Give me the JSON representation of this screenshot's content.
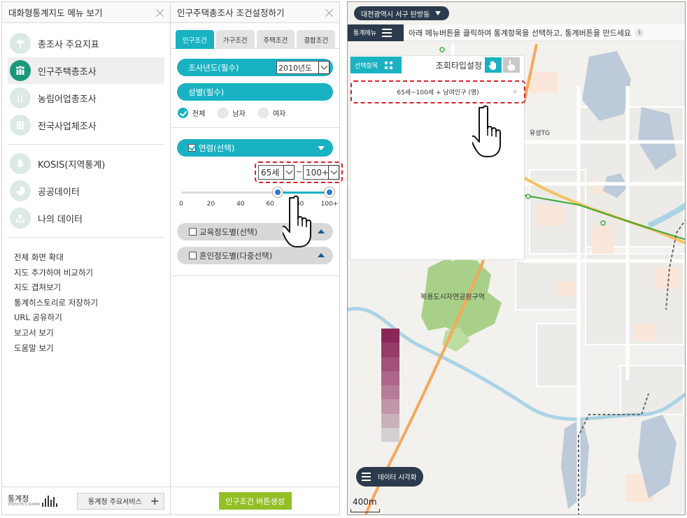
{
  "left_panel": {
    "title": "대화형통계지도 메뉴 보기",
    "menu_items": [
      {
        "label": "총조사 주요지표",
        "icon": "signpost-icon",
        "active": false
      },
      {
        "label": "인구주택총조사",
        "icon": "people-icon",
        "active": true
      },
      {
        "label": "농림어업총조사",
        "icon": "farm-icon",
        "active": false
      },
      {
        "label": "전국사업체조사",
        "icon": "building-icon",
        "active": false
      },
      {
        "label": "KOSIS(지역통계)",
        "icon": "region-icon",
        "active": false
      },
      {
        "label": "공공데이터",
        "icon": "pie-icon",
        "active": false
      },
      {
        "label": "나의 데이터",
        "icon": "upload-icon",
        "active": false
      }
    ],
    "links": [
      "전체 화면 확대",
      "지도 추가하여 비교하기",
      "지도 겹쳐보기",
      "통계히스토리로 저장하기",
      "URL 공유하기",
      "보고서 보기",
      "도움말 보기"
    ],
    "footer": {
      "logo_text": "통계청",
      "logo_sub": "STATISTICS KOREA",
      "services_label": "통계청 주요서비스",
      "plus": "+"
    }
  },
  "mid_panel": {
    "title": "인구주택총조사 조건설정하기",
    "tabs": [
      {
        "label": "인구조건",
        "active": true
      },
      {
        "label": "가구조건",
        "active": false
      },
      {
        "label": "주택조건",
        "active": false
      },
      {
        "label": "결합조건",
        "active": false
      }
    ],
    "year_label": "조사년도(필수)",
    "year_value": "2010년도",
    "gender_label": "성별(필수)",
    "gender_options": [
      {
        "label": "전체",
        "checked": true
      },
      {
        "label": "남자",
        "checked": false
      },
      {
        "label": "여자",
        "checked": false
      }
    ],
    "age_label": "연령(선택)",
    "age_from": "65세",
    "age_tilde": "~",
    "age_to": "100+",
    "slider": {
      "min": 0,
      "max": 100,
      "low": 65,
      "high": 100,
      "ticks": [
        "0",
        "20",
        "40",
        "60",
        "80",
        "100+"
      ]
    },
    "education_label": "교육정도별(선택)",
    "marital_label": "혼인정도별(다중선택)",
    "generate_button": "인구조건 버튼생성"
  },
  "map_panel": {
    "location": "대전광역시 서구 탄방동",
    "stat_menu_label": "통계메뉴",
    "hint": "아래 메뉴버튼을 클릭하여 통계항목을 선택하고, 통계버튼을 만드세요",
    "info": "i",
    "select_items_label": "선택항목",
    "type_setting_label": "조회타입설정",
    "selected_item": "65세~100세 + 남여인구 (명)",
    "map_labels": {
      "park": "복용도시자연공원구역",
      "tg": "유성TG"
    },
    "legend_colors": [
      "#8a2658",
      "#973b68",
      "#a3507a",
      "#ad6589",
      "#b77c98",
      "#c196aa",
      "#cab2bc",
      "#d4d0d2"
    ],
    "viz_button": "데이터 시각화",
    "scale": "400m"
  }
}
